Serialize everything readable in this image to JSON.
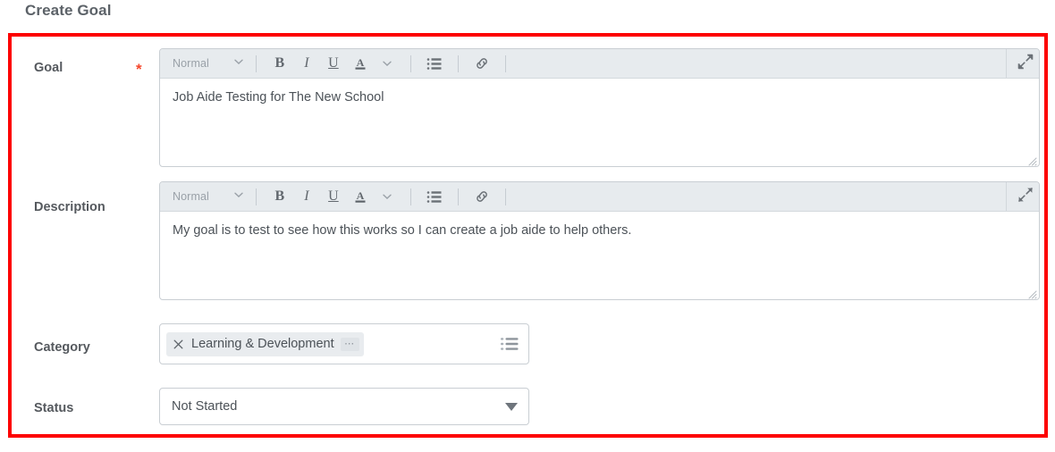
{
  "page": {
    "title": "Create Goal"
  },
  "highlight": {
    "color": "#fd0000"
  },
  "toolbar": {
    "style_name": "Normal",
    "bold_label": "B",
    "italic_label": "I",
    "underline_label": "U",
    "text_color_label": "A",
    "more_dots": "⋯"
  },
  "fields": {
    "goal": {
      "label": "Goal",
      "required_marker": "*",
      "value": "Job Aide Testing for The New School"
    },
    "description": {
      "label": "Description",
      "value": "My goal is to test to see how this works so I can create a job aide to help others."
    },
    "category": {
      "label": "Category",
      "chip_label": "Learning & Development"
    },
    "status": {
      "label": "Status",
      "value": "Not Started"
    }
  },
  "icons": {
    "chevron_down": "chevron-down-icon",
    "bulleted_list": "bulleted-list-icon",
    "link": "link-icon",
    "expand": "expand-icon",
    "resize": "resize-grip-icon",
    "chip_remove": "close-x-icon",
    "prompt_list": "prompt-list-icon",
    "dropdown_caret": "caret-down-icon"
  },
  "colors": {
    "toolbar_bg": "#e7ebee",
    "field_border": "#c9ced3",
    "label_text": "#55595e",
    "value_text": "#4c5258",
    "required_star": "#f5472c",
    "highlight_border": "#fd0000",
    "chip_bg": "#e9ecef"
  }
}
